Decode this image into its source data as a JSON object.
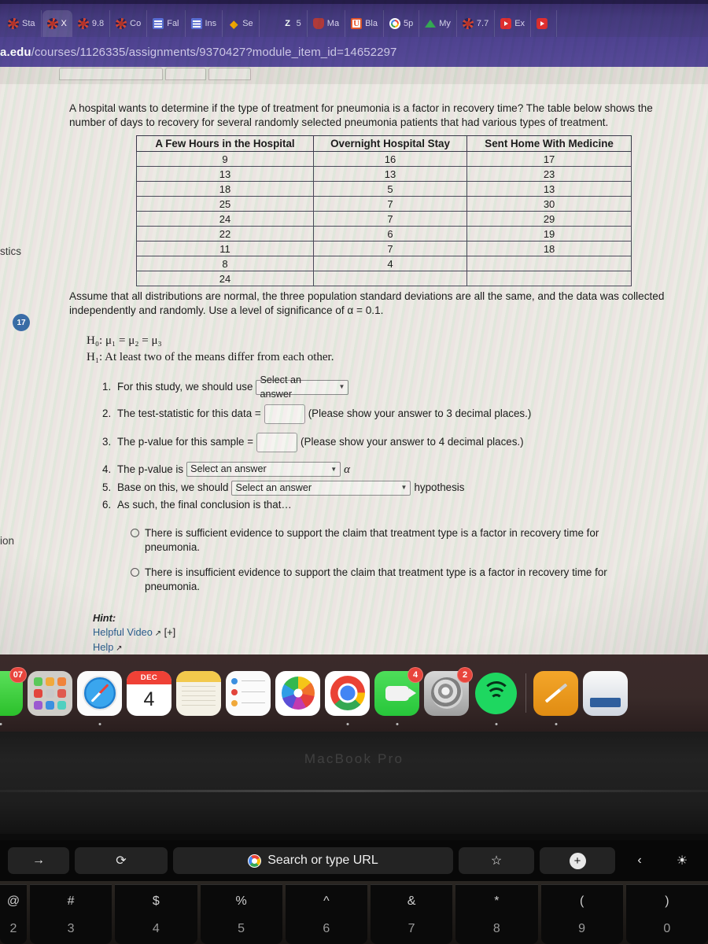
{
  "browser": {
    "tabs": [
      {
        "label": "Sta",
        "icon": "canvas-icon",
        "active": false
      },
      {
        "label": "X",
        "icon": "canvas-icon",
        "active": true
      },
      {
        "label": "9.8",
        "icon": "canvas-icon",
        "active": false
      },
      {
        "label": "Co",
        "icon": "canvas-icon",
        "active": false
      },
      {
        "label": "Fal",
        "icon": "list-icon",
        "active": false
      },
      {
        "label": "Ins",
        "icon": "list-icon",
        "active": false
      },
      {
        "label": "Se",
        "icon": "flame-icon",
        "active": false
      },
      {
        "label": "5",
        "icon": "zoom-icon",
        "active": false
      },
      {
        "label": "Ma",
        "icon": "shield-icon",
        "active": false
      },
      {
        "label": "Bla",
        "icon": "u-icon",
        "active": false
      },
      {
        "label": "5p",
        "icon": "google-icon",
        "active": false
      },
      {
        "label": "My",
        "icon": "drive-icon",
        "active": false
      },
      {
        "label": "7.7",
        "icon": "canvas-icon",
        "active": false
      },
      {
        "label": "Ex",
        "icon": "youtube-icon",
        "active": false
      },
      {
        "label": "",
        "icon": "youtube-icon",
        "active": false
      }
    ],
    "url_prefix": "a.edu",
    "url_rest": "/courses/1126335/assignments/9370427?module_item_id=14652297"
  },
  "page": {
    "edge_text_left_top": "stics",
    "edge_text_left_bottom": "ion",
    "unread_badge": "17",
    "prompt": "A hospital wants to determine if the type of treatment for pneumonia is a factor in recovery time? The table below shows the number of days to recovery for several randomly selected pneumonia patients that had various types of treatment.",
    "table": {
      "headers": [
        "A Few Hours in the Hospital",
        "Overnight Hospital Stay",
        "Sent Home With Medicine"
      ],
      "rows": [
        [
          "9",
          "16",
          "17"
        ],
        [
          "13",
          "13",
          "23"
        ],
        [
          "18",
          "5",
          "13"
        ],
        [
          "25",
          "7",
          "30"
        ],
        [
          "24",
          "7",
          "29"
        ],
        [
          "22",
          "6",
          "19"
        ],
        [
          "11",
          "7",
          "18"
        ],
        [
          "8",
          "4",
          ""
        ],
        [
          "24",
          "",
          ""
        ]
      ]
    },
    "assume_text": "Assume that all distributions are normal, the three population standard deviations are all the same, and the data was collected independently and randomly. Use a level of significance of α = 0.1.",
    "hypothesis_null": "H₀: μ₁ = μ₂ = μ₃",
    "hypothesis_alt": "H₁: At least two of the means differ from each other.",
    "steps": [
      {
        "num": "1.",
        "before": "For this study, we should use",
        "control": "select",
        "select_value": "Select an answer",
        "select_width": 118,
        "after": ""
      },
      {
        "num": "2.",
        "before": "The test-statistic for this data =",
        "control": "textbox",
        "after": "(Please show your answer to 3 decimal places.)"
      },
      {
        "num": "3.",
        "before": "The p-value for this sample =",
        "control": "textbox",
        "after": "(Please show your answer to 4 decimal places.)"
      },
      {
        "num": "4.",
        "before": "The p-value is",
        "control": "select",
        "select_value": "Select an answer",
        "select_width": 196,
        "after": "α"
      },
      {
        "num": "5.",
        "before": "Base on this, we should",
        "control": "select",
        "select_value": "Select an answer",
        "select_width": 228,
        "after": "hypothesis"
      },
      {
        "num": "6.",
        "before": "As such, the final conclusion is that…",
        "control": "none",
        "after": ""
      }
    ],
    "choices": [
      "There is sufficient evidence to support the claim that treatment type is a factor in recovery time for pneumonia.",
      "There is insufficient evidence to support the claim that treatment type is a factor in recovery time for pneumonia."
    ],
    "hint": {
      "label": "Hint:",
      "video_link": "Helpful Video",
      "expand": "[+]",
      "help_link": "Help"
    }
  },
  "dock": {
    "items": [
      {
        "name": "messages",
        "badge": "07"
      },
      {
        "name": "launchpad",
        "badge": ""
      },
      {
        "name": "safari",
        "badge": ""
      },
      {
        "name": "calendar",
        "badge": "",
        "month": "DEC",
        "day": "4"
      },
      {
        "name": "notes",
        "badge": ""
      },
      {
        "name": "reminders",
        "badge": ""
      },
      {
        "name": "photos",
        "badge": ""
      },
      {
        "name": "chrome",
        "badge": ""
      },
      {
        "name": "facetime",
        "badge": "4"
      },
      {
        "name": "system-preferences",
        "badge": "2"
      },
      {
        "name": "spotify",
        "badge": ""
      },
      {
        "name": "pages",
        "badge": ""
      },
      {
        "name": "finder-doc",
        "badge": ""
      }
    ]
  },
  "laptop": {
    "model_text": "MacBook Pro"
  },
  "touchbar": {
    "forward": "→",
    "reload": "⟳",
    "search_label": "Search or type URL",
    "bookmark": "☆",
    "newtab": "+",
    "back_chevron": "‹",
    "brightness": "☀"
  },
  "keyboard": {
    "keys": [
      {
        "top": "@",
        "bottom": "2"
      },
      {
        "top": "#",
        "bottom": "3"
      },
      {
        "top": "$",
        "bottom": "4"
      },
      {
        "top": "%",
        "bottom": "5"
      },
      {
        "top": "^",
        "bottom": "6"
      },
      {
        "top": "&",
        "bottom": "7"
      },
      {
        "top": "*",
        "bottom": "8"
      },
      {
        "top": "(",
        "bottom": "9"
      },
      {
        "top": ")",
        "bottom": "0"
      }
    ]
  }
}
